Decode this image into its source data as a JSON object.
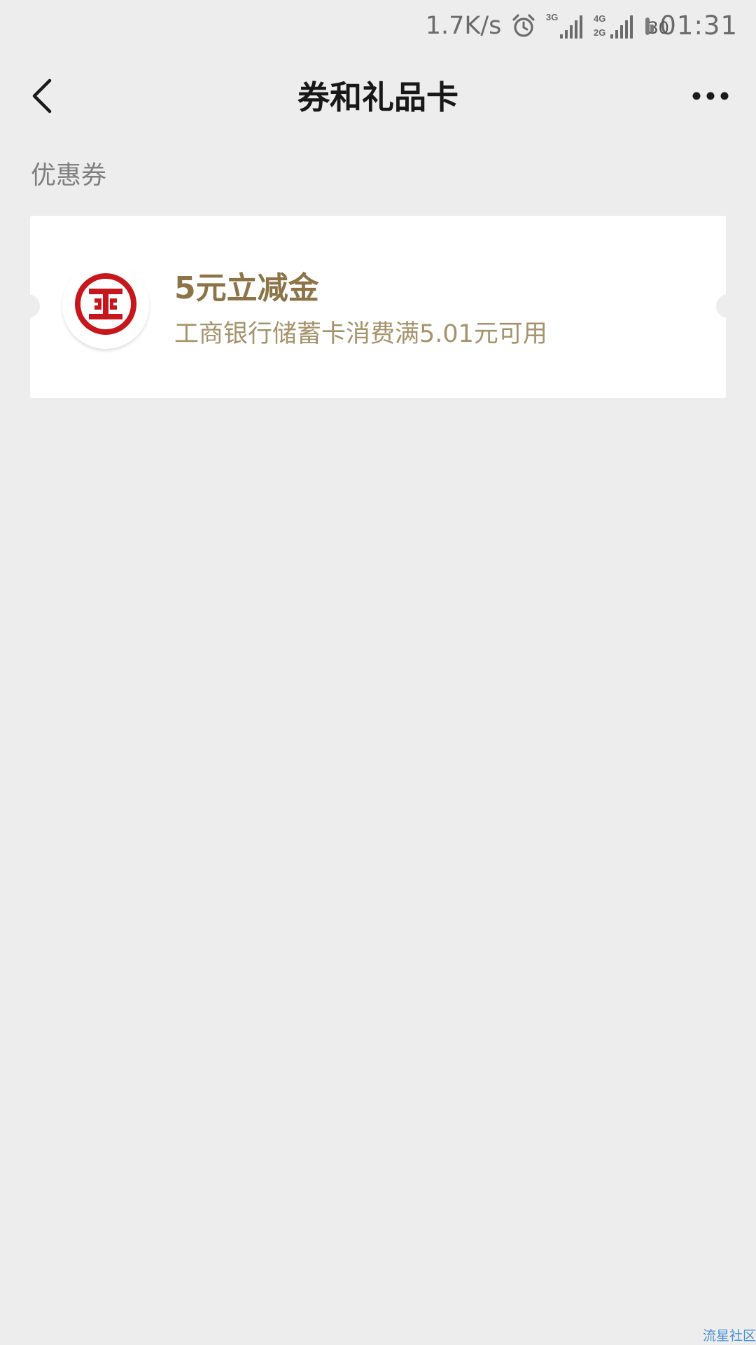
{
  "status_bar": {
    "net_speed": "1.7K/s",
    "network_a": "3G",
    "network_b_top": "4G",
    "network_b_bottom": "2G",
    "battery_level": "30",
    "time": "01:31",
    "icons": [
      "alarm-icon",
      "signal-3g-icon",
      "signal-4g-2g-icon",
      "battery-icon"
    ]
  },
  "nav": {
    "title": "券和礼品卡",
    "back_icon": "chevron-left-icon",
    "more_icon": "more-dots-icon"
  },
  "section": {
    "title": "优惠券"
  },
  "coupon": {
    "logo_icon": "icbc-logo-icon",
    "title": "5元立减金",
    "description": "工商银行储蓄卡消费满5.01元可用"
  },
  "watermark": {
    "text": "流星社区"
  },
  "colors": {
    "background": "#ededed",
    "card": "#ffffff",
    "coupon_title": "#8c7447",
    "coupon_desc": "#a5936b",
    "icbc_red": "#c8161d",
    "watermark": "#4a8fd6"
  }
}
